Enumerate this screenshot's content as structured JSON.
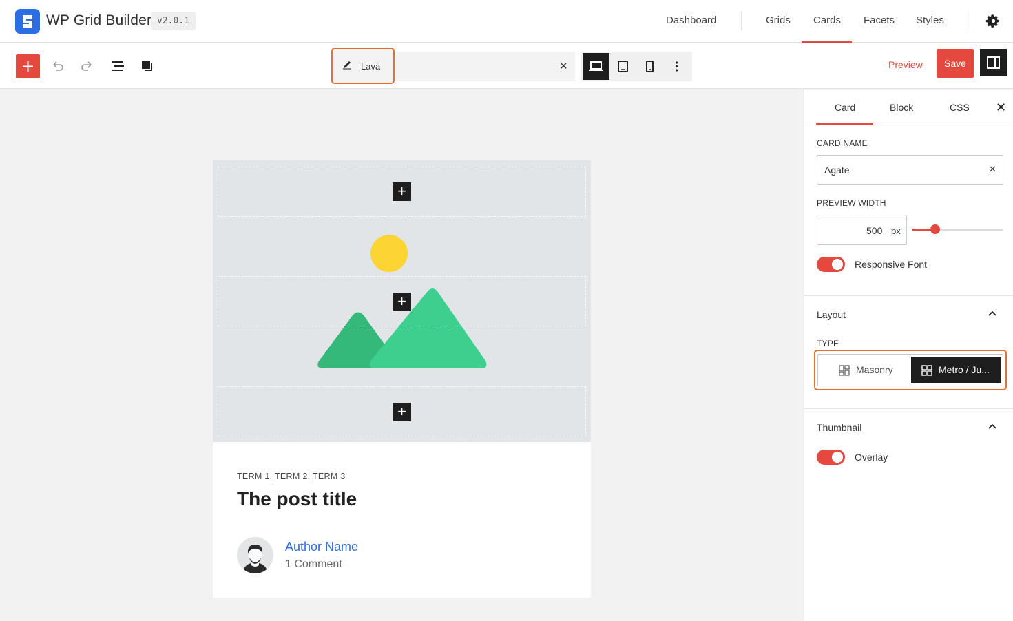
{
  "app": {
    "title": "WP Grid Builder",
    "version": "v2.0.1"
  },
  "nav": {
    "items": [
      "Dashboard",
      "Grids",
      "Cards",
      "Facets",
      "Styles"
    ],
    "active": "Cards"
  },
  "toolbar": {
    "card_title": "Lava",
    "preview": "Preview",
    "save": "Save"
  },
  "card": {
    "terms": "TERM 1, TERM 2, TERM 3",
    "title": "The post title",
    "author": "Author Name",
    "comments": "1 Comment"
  },
  "panel": {
    "tabs": [
      "Card",
      "Block",
      "CSS"
    ],
    "active_tab": "Card",
    "card_name_label": "CARD NAME",
    "card_name_value": "Agate",
    "preview_width_label": "PREVIEW WIDTH",
    "preview_width_value": "500",
    "preview_width_unit": "px",
    "preview_width_slider_fraction": 0.25,
    "responsive_font_label": "Responsive Font",
    "responsive_font_on": true,
    "layout_title": "Layout",
    "type_label": "TYPE",
    "type_options": [
      "Masonry",
      "Metro / Ju..."
    ],
    "type_selected": "Metro / Ju...",
    "thumbnail_title": "Thumbnail",
    "overlay_label": "Overlay",
    "overlay_on": true
  },
  "colors": {
    "accent": "#e5483f",
    "brand": "#2b6de3",
    "highlight": "#ea6d2a",
    "dark": "#1e1e1e"
  }
}
